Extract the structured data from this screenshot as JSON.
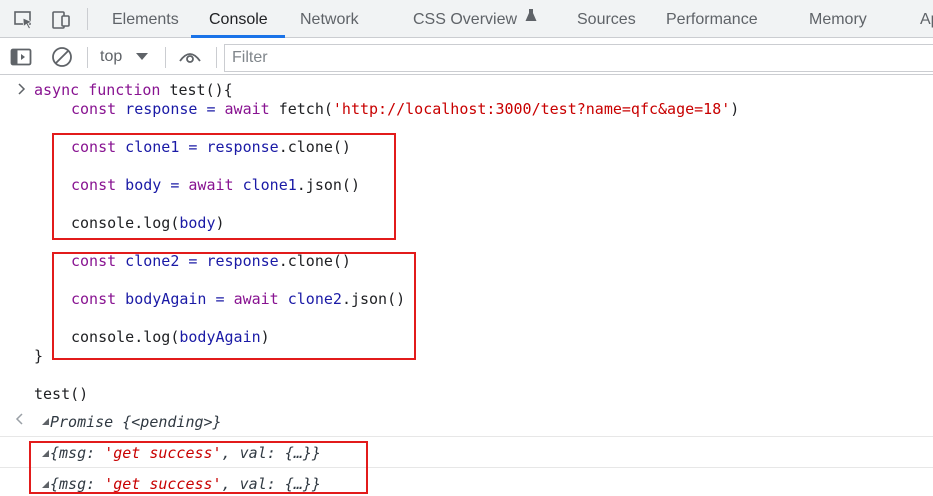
{
  "tabs": {
    "items": [
      {
        "label": "Elements"
      },
      {
        "label": "Console"
      },
      {
        "label": "Network"
      },
      {
        "label": "CSS Overview"
      },
      {
        "label": "Sources"
      },
      {
        "label": "Performance"
      },
      {
        "label": "Memory"
      },
      {
        "label": "Ap"
      }
    ],
    "active": "Console"
  },
  "toolbar": {
    "context": "top",
    "filter_placeholder": "Filter"
  },
  "code": {
    "l1": {
      "a": "async",
      "b": " ",
      "c": "function",
      "d": " test(){"
    },
    "l2": {
      "a": "const",
      "b": " response = ",
      "c": "await",
      "d": " fetch(",
      "e": "'http://localhost:3000/test?name=qfc&age=18'",
      "f": ")"
    },
    "l3": {
      "a": "const",
      "b": " clone1 = response",
      "c": ".clone()"
    },
    "l4": {
      "a": "const",
      "b": " body = ",
      "c": "await",
      "d": " clone1",
      "e": ".json()"
    },
    "l5": {
      "a": "console.log(",
      "b": "body",
      "c": ")"
    },
    "l6": {
      "a": "const",
      "b": " clone2 = response",
      "c": ".clone()"
    },
    "l7": {
      "a": "const",
      "b": " bodyAgain = ",
      "c": "await",
      "d": " clone2",
      "e": ".json()"
    },
    "l8": {
      "a": "console.log(",
      "b": "bodyAgain",
      "c": ")"
    },
    "l9": "}",
    "l10": "test()"
  },
  "output": {
    "promise": "Promise {<pending>}",
    "log1": {
      "a": "{msg: ",
      "b": "'get success'",
      "c": ", val: {…}}"
    },
    "log2": {
      "a": "{msg: ",
      "b": "'get success'",
      "c": ", val: {…}}"
    }
  },
  "colors": {
    "keyword": "#881391",
    "variable": "#1a1aa6",
    "string": "#c80000",
    "highlight_box": "#e21b1b",
    "active_tab_underline": "#1a73e8"
  },
  "icons": [
    "inspect-element-icon",
    "device-toolbar-icon",
    "sidebar-toggle-icon",
    "clear-console-icon",
    "dropdown-arrow-icon",
    "live-expression-eye-icon",
    "beaker-icon",
    "prompt-chevron-icon",
    "result-back-arrow-icon",
    "expand-triangle-icon"
  ]
}
